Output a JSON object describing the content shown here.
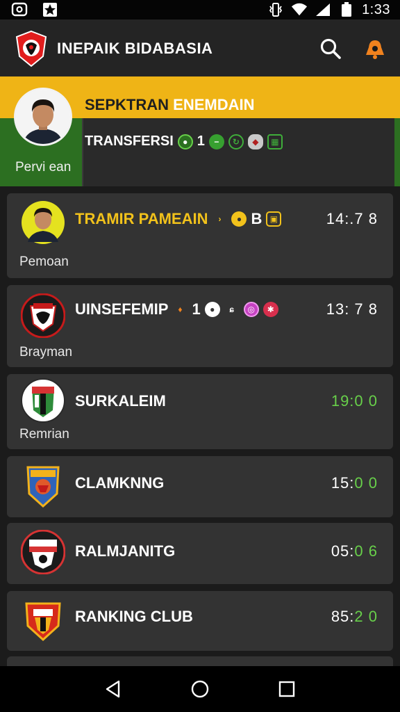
{
  "status_bar": {
    "time": "1:33",
    "icons": [
      "cast-icon",
      "star-icon",
      "vibrate-icon",
      "wifi-icon",
      "signal-icon",
      "battery-icon"
    ]
  },
  "app_bar": {
    "title": "INEPAIK BIDABASIA",
    "icons": [
      "search-icon",
      "notification-icon"
    ]
  },
  "featured": {
    "title_dark": "SEPKTRAN",
    "title_light": "ENEMDAIN",
    "subtitle": "TRANSFERSI",
    "subtitle_extra": "1",
    "caption": "Pervi ean"
  },
  "matches": [
    {
      "name": "TRAMIR PAMEAIN",
      "suffix": "B",
      "time": "14:.7 8",
      "caption": "Pemoan",
      "name_color": "#f2c21b"
    },
    {
      "name": "UINSEFEMIP",
      "suffix": "1",
      "time": "13: 7 8",
      "caption": "Brayman",
      "name_color": "#ffffff"
    },
    {
      "name": "SURKALEIM",
      "suffix": "",
      "time": "19:0 0",
      "caption": "Remrian",
      "name_color": "#ffffff"
    },
    {
      "name": "CLAMKNNG",
      "suffix": "",
      "time_a": "15:",
      "time_b": "0 0",
      "name_color": "#ffffff"
    },
    {
      "name": "RALMJANITG",
      "suffix": "",
      "time_a": "05:",
      "time_b": "0 6",
      "name_color": "#ffffff"
    },
    {
      "name": "RANKING CLUB",
      "suffix": "",
      "time_a": "85:",
      "time_b": "2 0",
      "name_color": "#ffffff"
    }
  ],
  "colors": {
    "accent_yellow": "#efb416",
    "accent_green": "#2c6f21",
    "time_green": "#68d04a",
    "card_bg": "#333333"
  }
}
